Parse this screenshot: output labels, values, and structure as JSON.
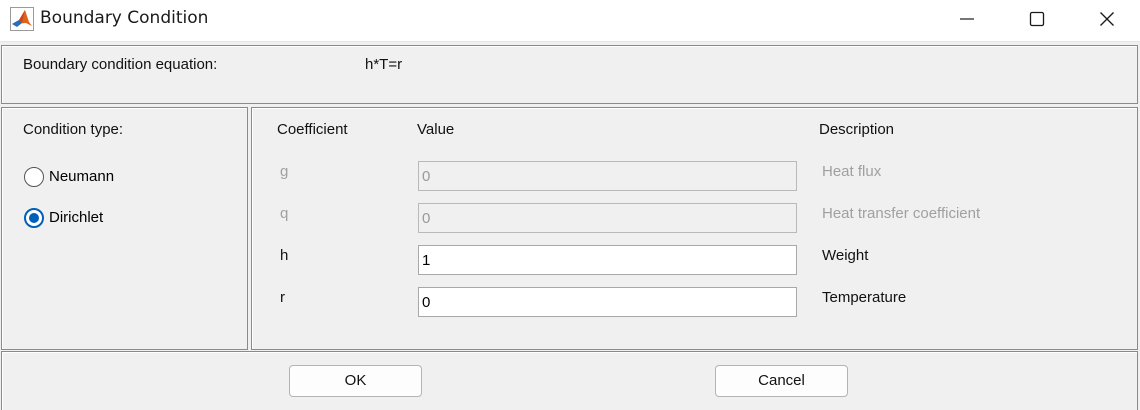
{
  "window": {
    "title": "Boundary Condition",
    "icon": "matlab-icon",
    "controls": [
      "minimize-icon",
      "maximize-icon",
      "close-icon"
    ]
  },
  "equation": {
    "label": "Boundary condition equation:",
    "value": "h*T=r"
  },
  "condition_type": {
    "label": "Condition type:",
    "options": [
      {
        "label": "Neumann",
        "selected": false
      },
      {
        "label": "Dirichlet",
        "selected": true
      }
    ]
  },
  "coefficients": {
    "headers": {
      "coefficient": "Coefficient",
      "value": "Value",
      "description": "Description"
    },
    "rows": [
      {
        "name": "g",
        "value": "0",
        "description": "Heat flux",
        "enabled": false
      },
      {
        "name": "q",
        "value": "0",
        "description": "Heat transfer coefficient",
        "enabled": false
      },
      {
        "name": "h",
        "value": "1",
        "description": "Weight",
        "enabled": true
      },
      {
        "name": "r",
        "value": "0",
        "description": "Temperature",
        "enabled": true
      }
    ]
  },
  "buttons": {
    "ok": "OK",
    "cancel": "Cancel"
  },
  "colors": {
    "accent": "#005fb8",
    "disabled_text": "#a0a0a0",
    "background": "#f0f0f0"
  }
}
